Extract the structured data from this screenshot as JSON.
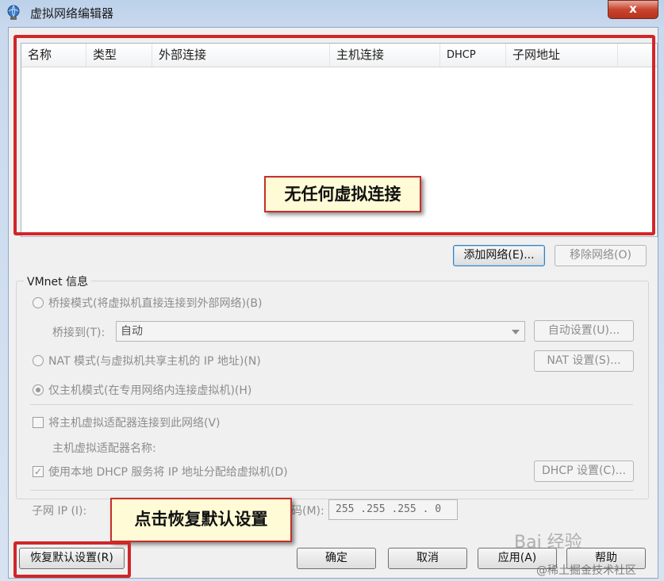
{
  "window": {
    "title": "虚拟网络编辑器",
    "close": "x"
  },
  "network_list": {
    "columns": [
      "名称",
      "类型",
      "外部连接",
      "主机连接",
      "DHCP",
      "子网地址"
    ],
    "empty_callout": "无任何虚拟连接"
  },
  "actions": {
    "add_network": "添加网络(E)...",
    "remove_network": "移除网络(O)"
  },
  "vmnet_info": {
    "title": "VMnet 信息",
    "bridged_mode": "桥接模式(将虚拟机直接连接到外部网络)(B)",
    "bridged_to_label": "桥接到(T):",
    "bridged_to_value": "自动",
    "auto_settings": "自动设置(U)...",
    "nat_mode": "NAT 模式(与虚拟机共享主机的 IP 地址)(N)",
    "nat_settings": "NAT 设置(S)...",
    "host_only_mode": "仅主机模式(在专用网络内连接虚拟机)(H)",
    "connect_adapter": "将主机虚拟适配器连接到此网络(V)",
    "adapter_name_label": "主机虚拟适配器名称:",
    "use_dhcp": "使用本地 DHCP 服务将 IP 地址分配给虚拟机(D)",
    "dhcp_settings": "DHCP 设置(C)...",
    "subnet_ip_label": "子网 IP (I):",
    "subnet_mask_label_tail": "码(M):",
    "subnet_mask_value": "255 .255 .255 . 0"
  },
  "footer": {
    "restore_defaults": "恢复默认设置(R)",
    "restore_callout": "点击恢复默认设置",
    "ok": "确定",
    "cancel": "取消",
    "apply": "应用(A)",
    "help": "帮助"
  },
  "watermarks": {
    "baidu": "Bai 经验",
    "juejin": "@稀土掘金技术社区"
  },
  "colors": {
    "highlight_red": "#d0262a",
    "callout_bg": "#fffbd6",
    "title_bg": "#c9d9ee"
  }
}
